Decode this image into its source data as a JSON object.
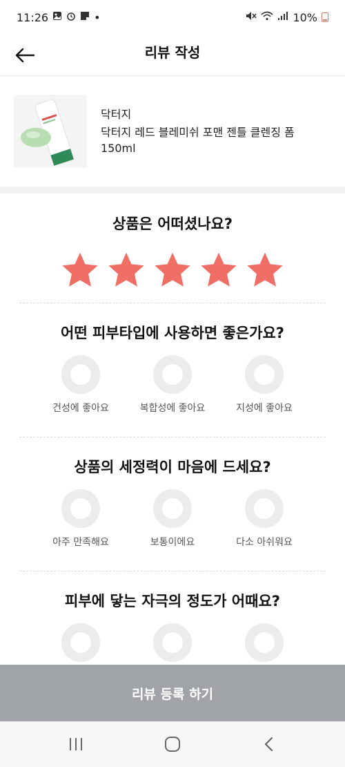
{
  "status_bar": {
    "time": "11:26",
    "dot": "•",
    "battery": "10%",
    "icons": [
      "image-icon",
      "alarm-icon",
      "note-icon",
      "mute-icon",
      "wifi-icon",
      "signal-icon",
      "battery-icon"
    ]
  },
  "header": {
    "title": "리뷰 작성",
    "back_icon": "arrow-left-icon"
  },
  "product": {
    "brand": "닥터지",
    "name": "닥터지 레드 블레미쉬 포맨 젠틀 클렌징 폼",
    "size": "150ml"
  },
  "rating": {
    "question": "상품은 어떠셨나요?",
    "stars": 5,
    "max": 5,
    "star_color": "#ef6f66"
  },
  "questions": [
    {
      "title": "어떤 피부타입에 사용하면 좋은가요?",
      "options": [
        "건성에 좋아요",
        "복합성에 좋아요",
        "지성에 좋아요"
      ]
    },
    {
      "title": "상품의 세정력이 마음에 드세요?",
      "options": [
        "아주 만족해요",
        "보통이에요",
        "다소 아쉬워요"
      ]
    },
    {
      "title": "피부에 닿는 자극의 정도가 어때요?",
      "options": [
        "",
        "",
        ""
      ]
    }
  ],
  "submit": {
    "label": "리뷰 등록 하기",
    "color": "#a0a4a8"
  },
  "nav": {
    "icons": [
      "recent-apps-icon",
      "home-icon",
      "back-icon"
    ]
  }
}
